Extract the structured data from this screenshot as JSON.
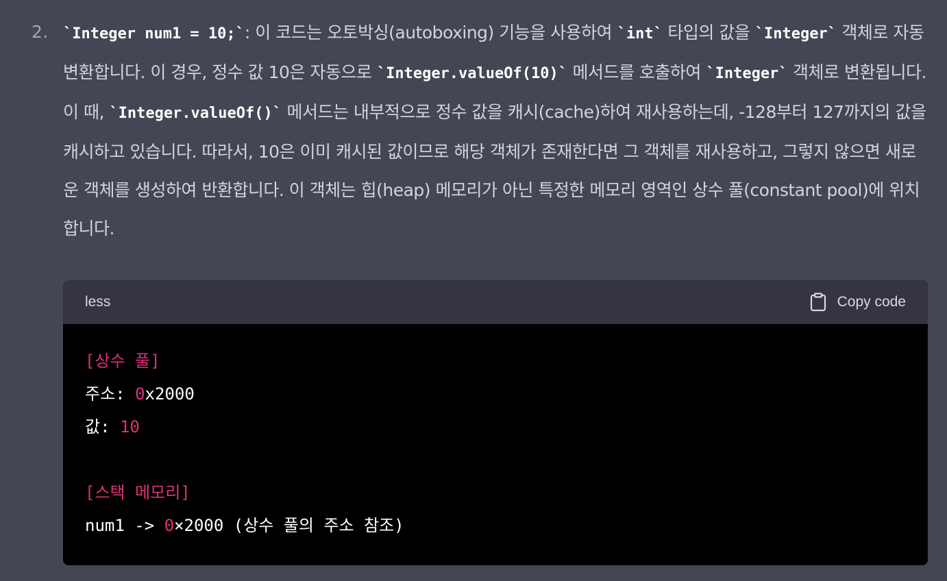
{
  "list_item": {
    "number": "2.",
    "paragraph": [
      {
        "t": "code",
        "v": "`Integer num1 = 10;`"
      },
      {
        "t": "text",
        "v": ": 이 코드는 오토박싱(autoboxing) 기능을 사용하여 "
      },
      {
        "t": "code",
        "v": "`int`"
      },
      {
        "t": "text",
        "v": " 타입의 값을 "
      },
      {
        "t": "code",
        "v": "`Integer`"
      },
      {
        "t": "text",
        "v": " 객체로 자동 변환합니다. 이 경우, 정수 값 10은 자동으로 "
      },
      {
        "t": "code",
        "v": "`Integer.valueOf(10)`"
      },
      {
        "t": "text",
        "v": " 메서드를 호출하여 "
      },
      {
        "t": "code",
        "v": "`Integer`"
      },
      {
        "t": "text",
        "v": " 객체로 변환됩니다. 이 때, "
      },
      {
        "t": "code",
        "v": "`Integer.valueOf()`"
      },
      {
        "t": "text",
        "v": " 메서드는 내부적으로 정수 값을 캐시(cache)하여 재사용하는데, -128부터 127까지의 값을 캐시하고 있습니다. 따라서, 10은 이미 캐시된 값이므로 해당 객체가 존재한다면 그 객체를 재사용하고, 그렇지 않으면 새로운 객체를 생성하여 반환합니다. 이 객체는 힙(heap) 메모리가 아닌 특정한 메모리 영역인 상수 풀(constant pool)에 위치합니다."
      }
    ]
  },
  "code_block": {
    "language": "less",
    "copy_label": "Copy code",
    "lines": [
      [
        {
          "v": "[상수 풀]",
          "hl": true
        }
      ],
      [
        {
          "v": "주소: ",
          "hl": false
        },
        {
          "v": "0",
          "hl": true
        },
        {
          "v": "x2000",
          "hl": false
        }
      ],
      [
        {
          "v": "값: ",
          "hl": false
        },
        {
          "v": "10",
          "hl": true
        }
      ],
      [],
      [
        {
          "v": "[스택 메모리]",
          "hl": true
        }
      ],
      [
        {
          "v": "num1 -> ",
          "hl": false
        },
        {
          "v": "0",
          "hl": true
        },
        {
          "v": "×2000 (상수 풀의 주소 참조)",
          "hl": false
        }
      ]
    ]
  },
  "colors": {
    "background": "#444654",
    "code_header_bg": "#343541",
    "code_body_bg": "#000000",
    "highlight": "#df3079"
  },
  "icons": {
    "copy": "clipboard-icon"
  }
}
